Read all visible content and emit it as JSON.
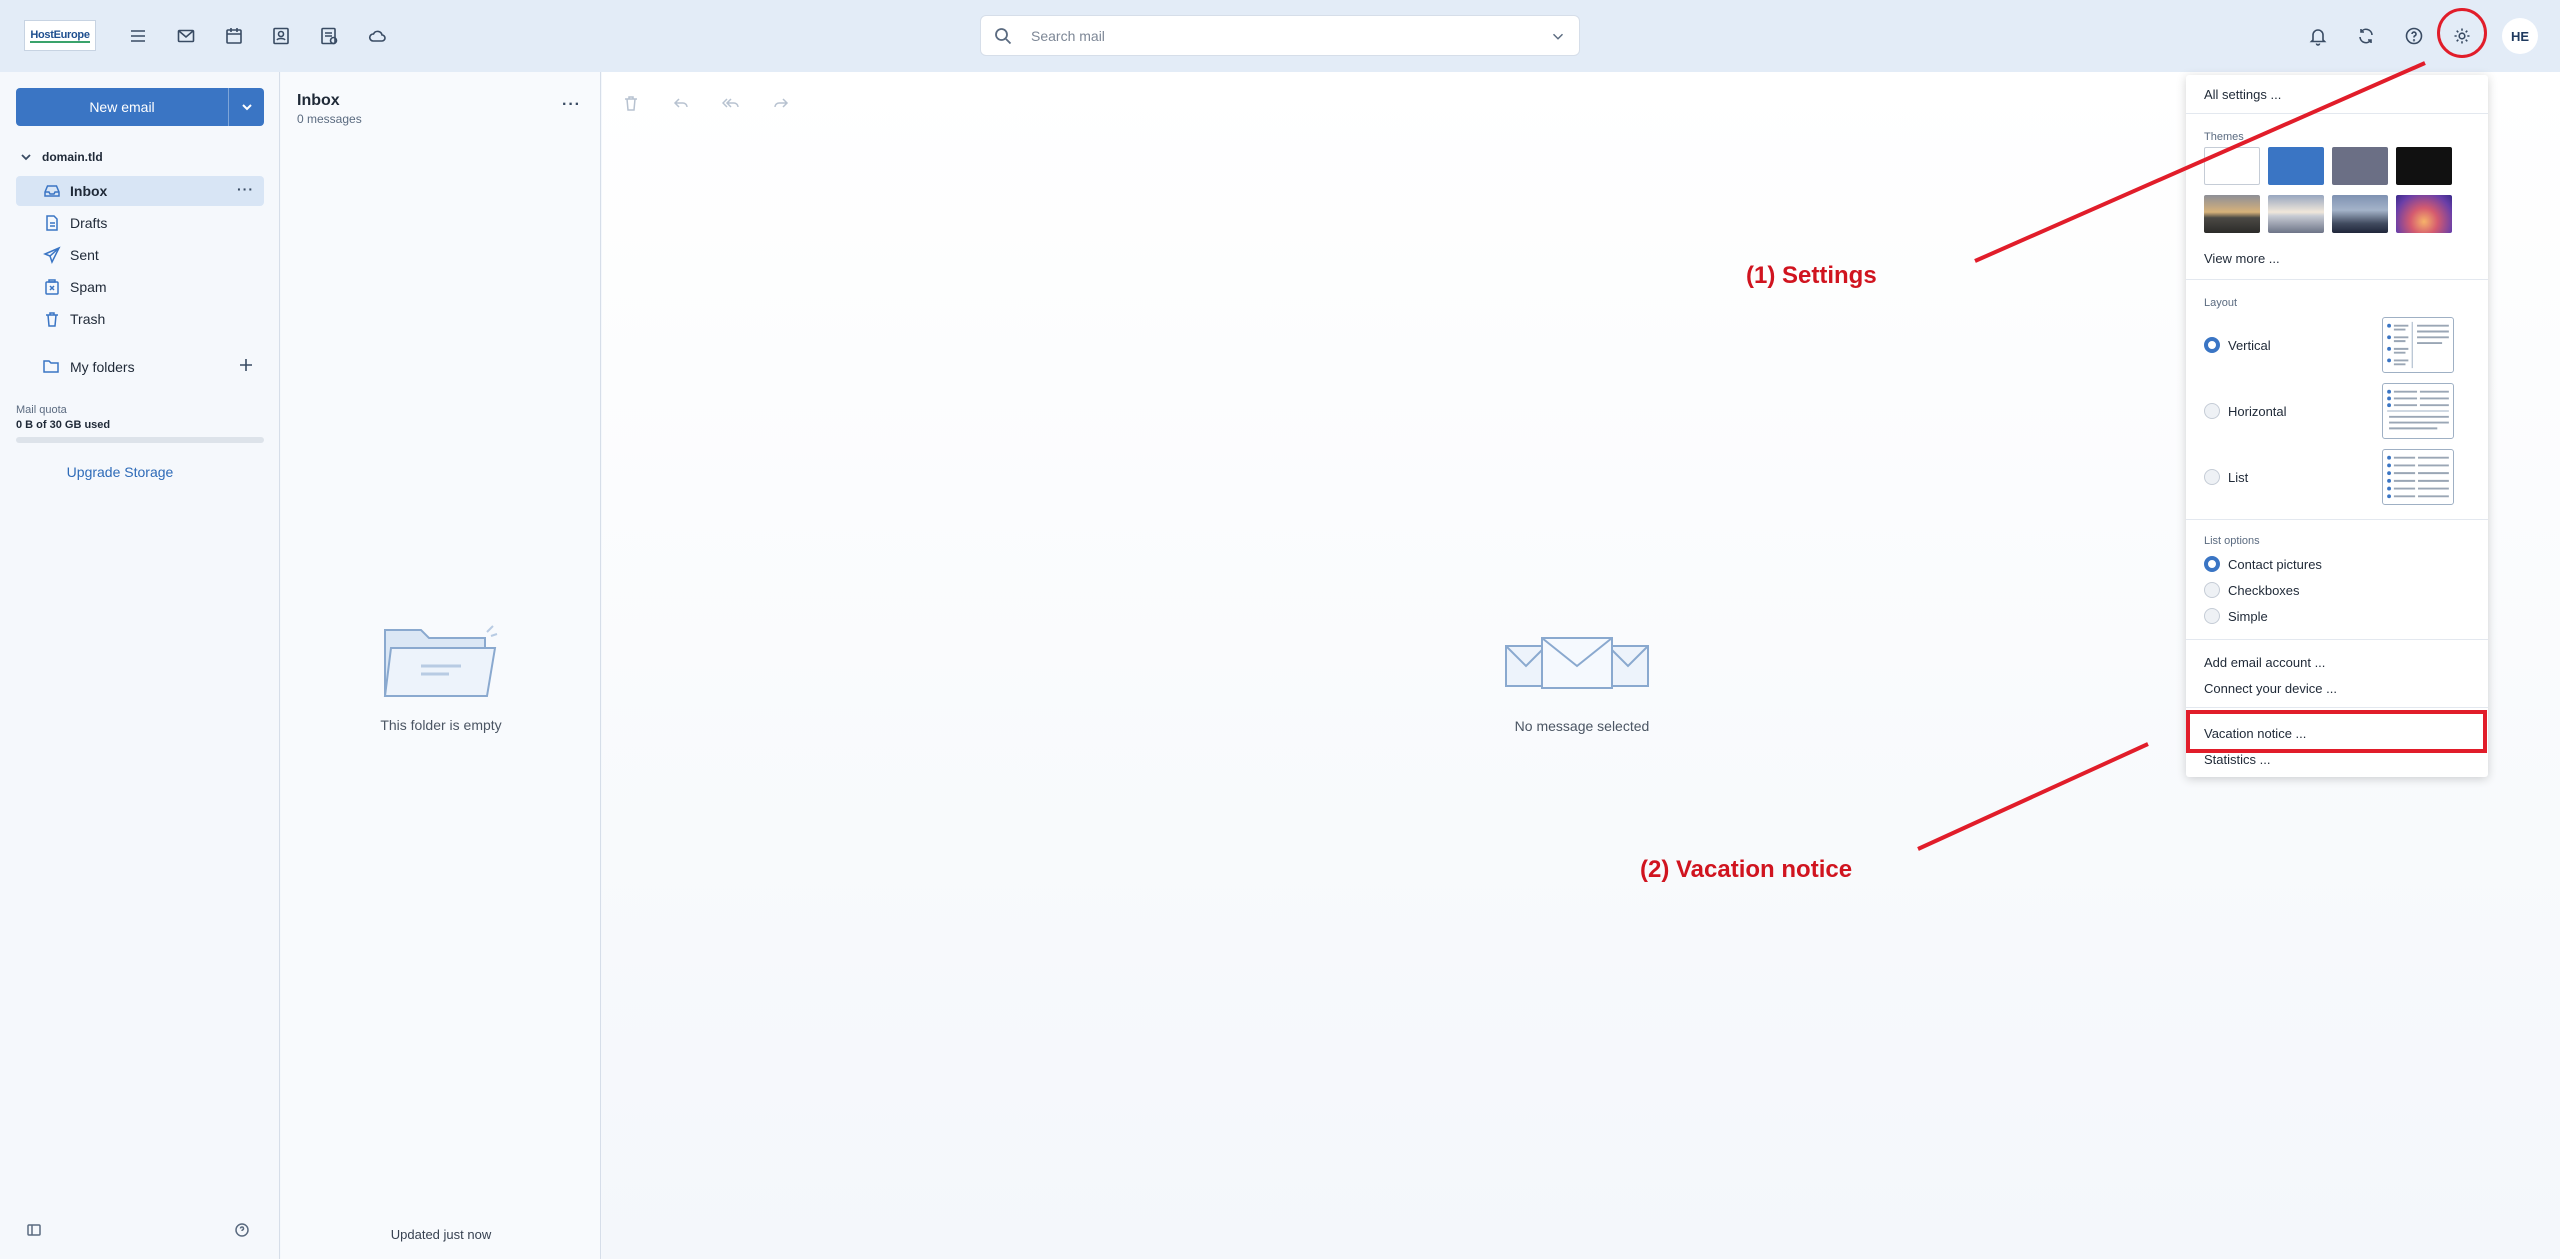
{
  "header": {
    "logo_text": "HostEurope",
    "search_placeholder": "Search mail",
    "avatar_initials": "HE",
    "icons": [
      "menu-icon",
      "mail-icon",
      "calendar-icon",
      "contacts-icon",
      "tasks-icon",
      "cloud-icon",
      "bell-icon",
      "refresh-icon",
      "help-icon",
      "gear-icon"
    ]
  },
  "sidebar": {
    "new_email_label": "New email",
    "account_name": "domain.tld",
    "folders": [
      {
        "label": "Inbox",
        "icon": "inbox-icon",
        "active": true
      },
      {
        "label": "Drafts",
        "icon": "drafts-icon"
      },
      {
        "label": "Sent",
        "icon": "sent-icon"
      },
      {
        "label": "Spam",
        "icon": "spam-icon"
      },
      {
        "label": "Trash",
        "icon": "trash-icon"
      }
    ],
    "my_folders_label": "My folders",
    "quota_label": "Mail quota",
    "quota_value": "0 B of 30 GB used",
    "quota_fraction": 0,
    "upgrade_label": "Upgrade Storage"
  },
  "message_list": {
    "title": "Inbox",
    "count": "0 messages",
    "empty_text": "This folder is empty",
    "updated_text": "Updated just now"
  },
  "reading_pane": {
    "empty_text": "No message selected"
  },
  "settings_menu": {
    "all_settings": "All settings ...",
    "themes_label": "Themes",
    "theme_colors": [
      "#ffffff",
      "#3a75c4",
      "#6b6f85",
      "#111111"
    ],
    "view_more": "View more ...",
    "layout_label": "Layout",
    "layouts": [
      {
        "label": "Vertical",
        "selected": true
      },
      {
        "label": "Horizontal",
        "selected": false
      },
      {
        "label": "List",
        "selected": false
      }
    ],
    "list_options_label": "List options",
    "list_options": [
      {
        "label": "Contact pictures",
        "selected": true
      },
      {
        "label": "Checkboxes",
        "selected": false
      },
      {
        "label": "Simple",
        "selected": false
      }
    ],
    "add_account": "Add email account ...",
    "connect_device": "Connect your device ...",
    "vacation_notice": "Vacation notice ...",
    "statistics": "Statistics ..."
  },
  "annotations": {
    "step1": "(1) Settings",
    "step2": "(2) Vacation notice",
    "color": "#e11d2a"
  }
}
